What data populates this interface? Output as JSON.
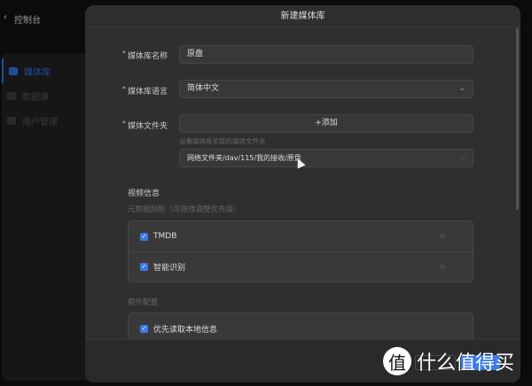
{
  "nav": {
    "back_label": "控制台",
    "items": [
      {
        "label": "媒体库",
        "active": true
      },
      {
        "label": "数据源"
      },
      {
        "label": "用户管理"
      }
    ]
  },
  "modal": {
    "title": "新建媒体库",
    "name": {
      "label": "媒体库名称",
      "value": "原盘"
    },
    "language": {
      "label": "媒体库语言",
      "value": "简体中文"
    },
    "folder": {
      "label": "媒体文件夹",
      "add_label": "+添加",
      "hint": "设置媒体库关联的媒体文件夹",
      "path": "网络文件夹/dav/115/我的接收/原盘"
    },
    "video_section": "视频信息",
    "scraper_hint": "元数据刮削（可拖拽调整优先级）",
    "scrapers": [
      {
        "label": "TMDB",
        "checked": true
      },
      {
        "label": "智能识别",
        "checked": true
      }
    ],
    "extra_section": "额外配置",
    "extra": [
      {
        "label": "优先读取本地信息",
        "checked": true
      }
    ]
  },
  "watermark": {
    "logo": "值",
    "text": "什么值得买"
  },
  "colors": {
    "accent": "#3b7be6"
  }
}
